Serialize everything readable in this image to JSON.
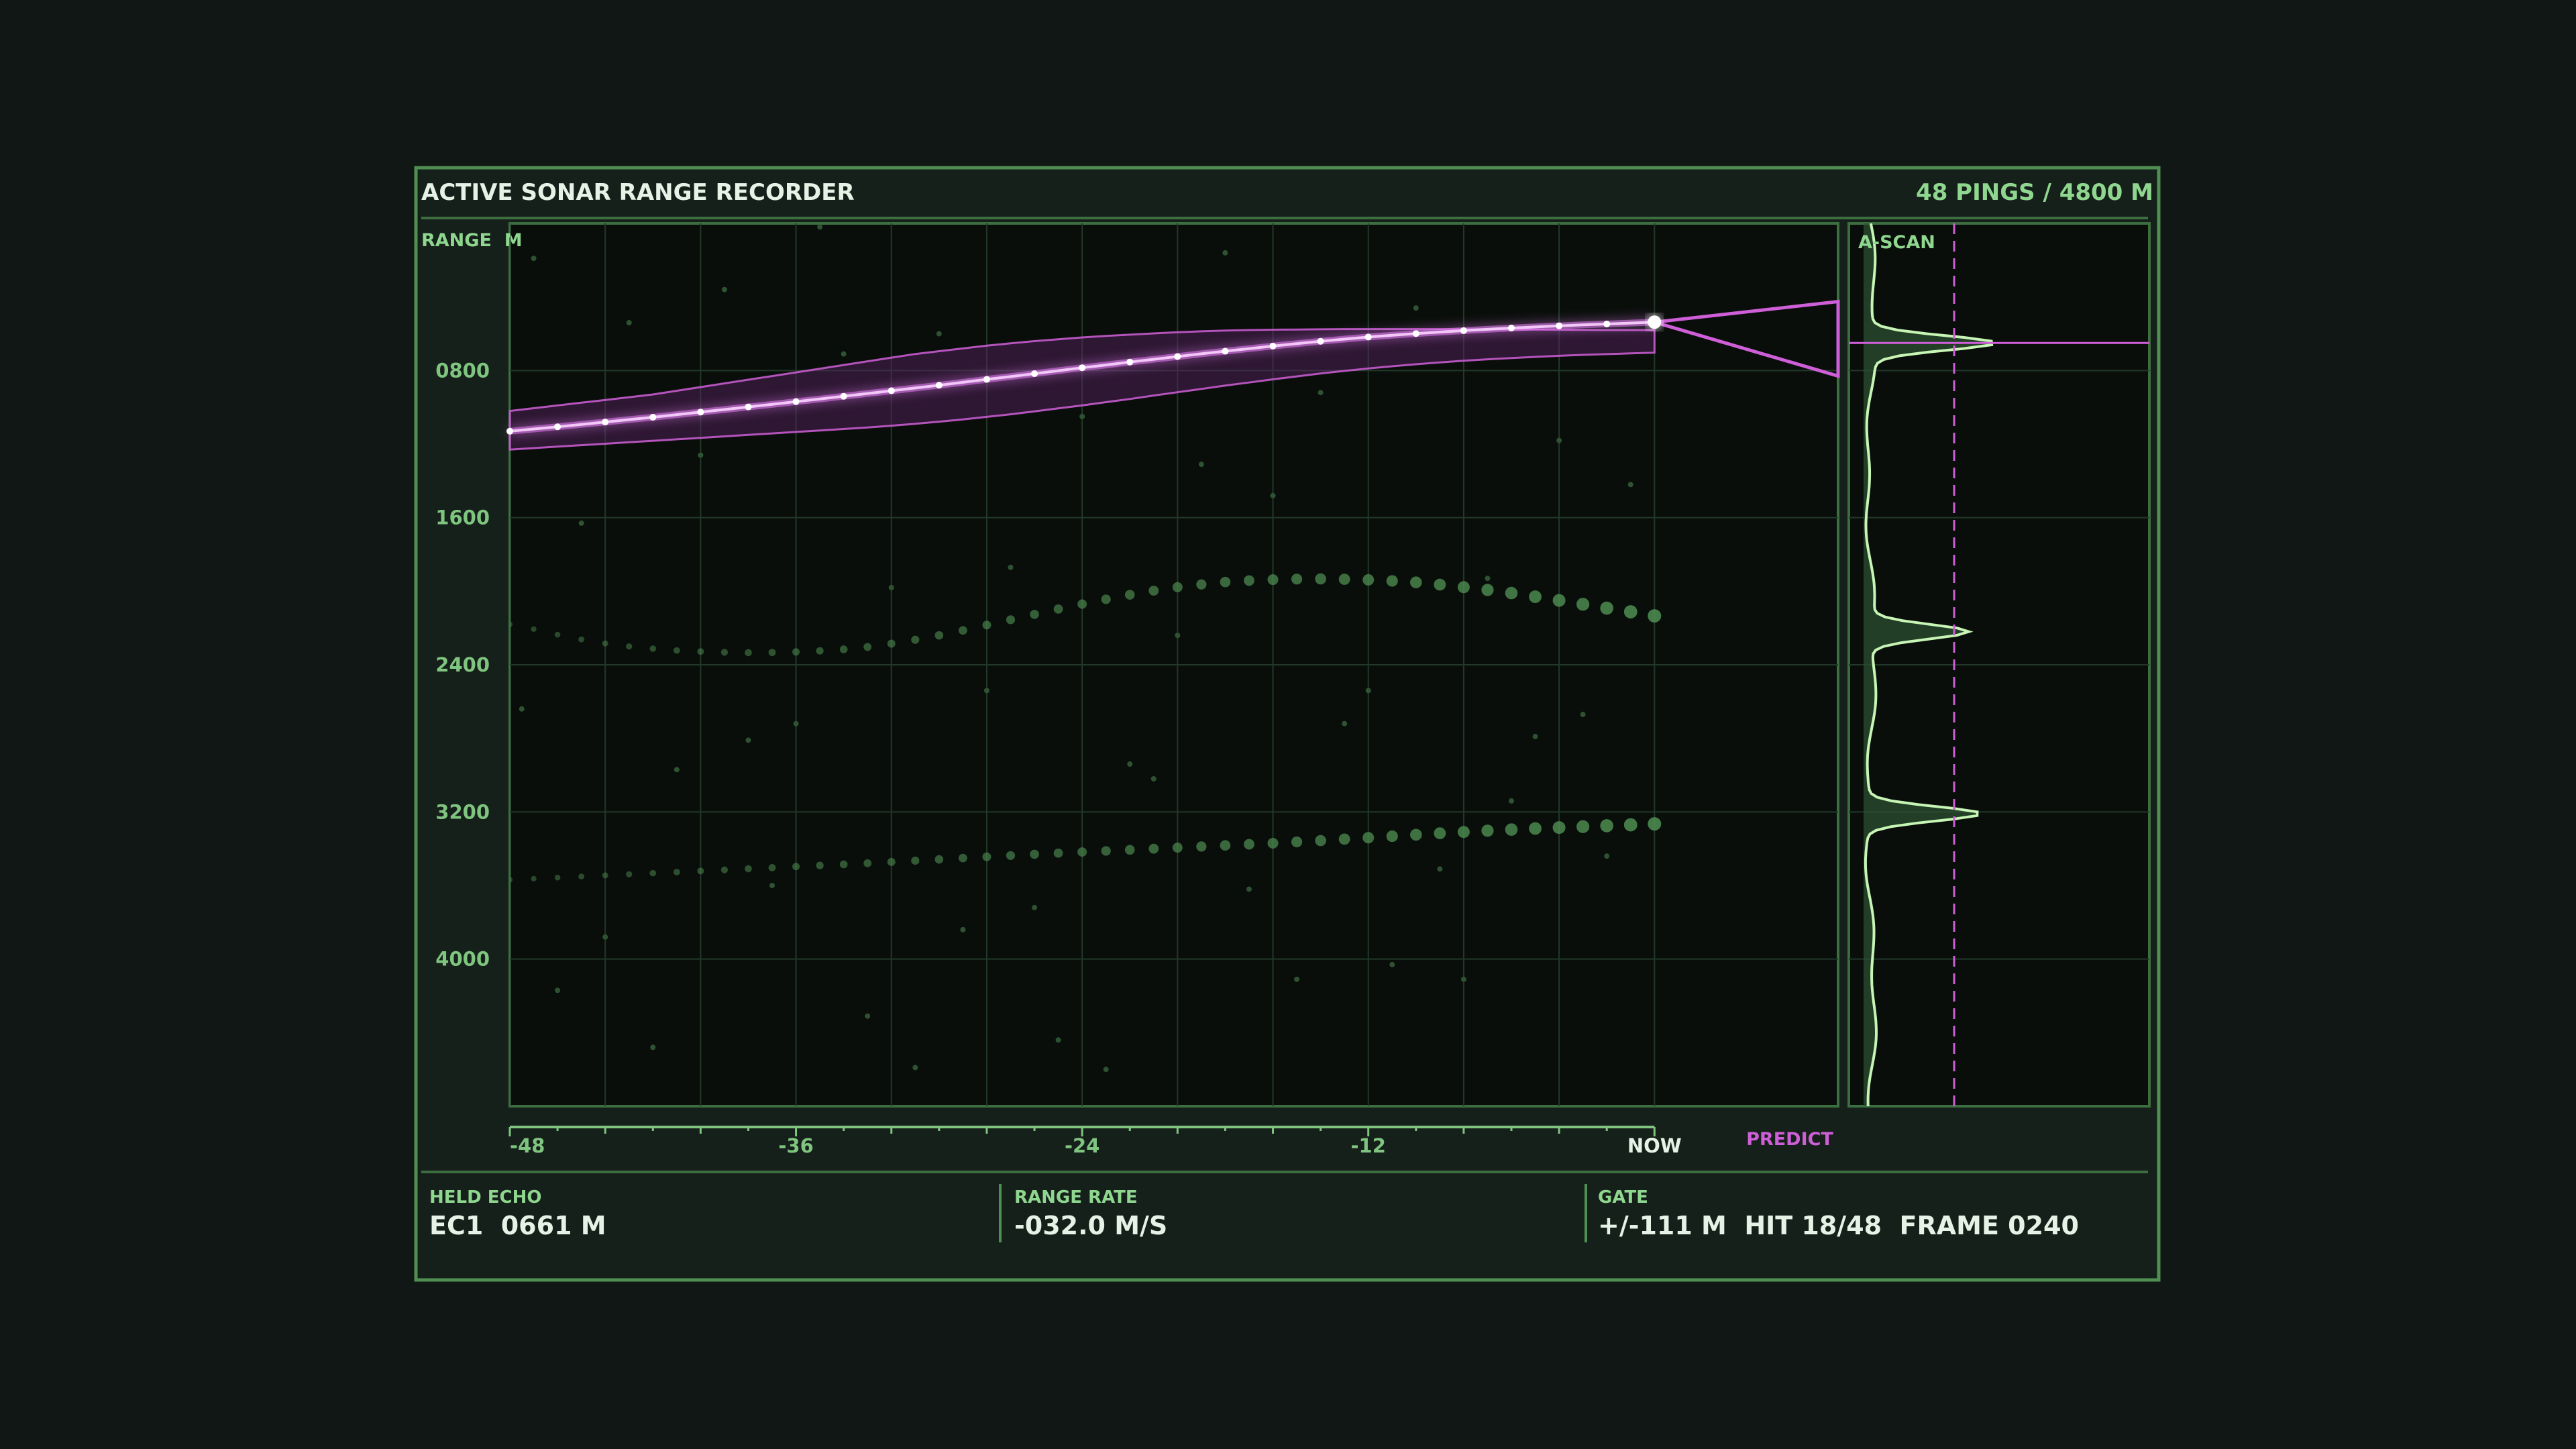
{
  "header": {
    "title": "ACTIVE SONAR RANGE RECORDER",
    "summary": "48 PINGS / 4800 M"
  },
  "colors": {
    "background": "#111714",
    "panel": "#16201b",
    "plot": "#0a0e0b",
    "accent_green": "#7fc47f",
    "grid": "#223828",
    "text_light": "#e6f2e6",
    "track_magenta": "#cf5fd8",
    "track_core": "#f3c8f8"
  },
  "chart_data": {
    "type": "scatter",
    "ylabel": "RANGE  M",
    "y_ticks": [
      "0800",
      "1600",
      "2400",
      "3200",
      "4000"
    ],
    "x_ticks": [
      "-48",
      "-36",
      "-24",
      "-12",
      "NOW"
    ],
    "predict_label": "PREDICT",
    "xlim": [
      -48,
      7.7
    ],
    "ylim": [
      0,
      4800
    ],
    "y_inverted": true,
    "grid": true,
    "held_track": {
      "x": [
        -48,
        -47,
        -46,
        -45,
        -44,
        -43,
        -42,
        -41,
        -40,
        -39,
        -38,
        -37,
        -36,
        -35,
        -34,
        -33,
        -32,
        -31,
        -30,
        -29,
        -28,
        -27,
        -26,
        -25,
        -24,
        -23,
        -22,
        -21,
        -20,
        -19,
        -18,
        -17,
        -16,
        -15,
        -14,
        -13,
        -12,
        -11,
        -10,
        -9,
        -8,
        -7,
        -6,
        -5,
        -4,
        -3,
        -2,
        -1,
        0
      ],
      "y": [
        1130,
        1118,
        1106,
        1093,
        1080,
        1067,
        1054,
        1040,
        1026,
        1012,
        998,
        984,
        969,
        955,
        940,
        925,
        910,
        895,
        880,
        864,
        848,
        833,
        817,
        801,
        785,
        770,
        754,
        739,
        724,
        709,
        695,
        681,
        667,
        654,
        641,
        629,
        618,
        608,
        599,
        591,
        583,
        576,
        569,
        563,
        557,
        552,
        547,
        542,
        537
      ],
      "band_upper": [
        1020,
        1005,
        990,
        975,
        960,
        945,
        930,
        910,
        890,
        870,
        850,
        830,
        810,
        790,
        770,
        750,
        730,
        710,
        695,
        680,
        665,
        652,
        640,
        630,
        620,
        612,
        605,
        598,
        592,
        587,
        583,
        580,
        578,
        577,
        576,
        575,
        575,
        575,
        575,
        575,
        576,
        576,
        577,
        577,
        578,
        579,
        580,
        580,
        580
      ],
      "band_lower": [
        1230,
        1222,
        1214,
        1206,
        1198,
        1190,
        1182,
        1174,
        1166,
        1158,
        1150,
        1142,
        1134,
        1126,
        1118,
        1110,
        1100,
        1090,
        1078,
        1066,
        1052,
        1038,
        1022,
        1006,
        990,
        972,
        955,
        936,
        918,
        900,
        882,
        865,
        848,
        832,
        816,
        802,
        789,
        777,
        766,
        756,
        747,
        739,
        732,
        726,
        720,
        715,
        711,
        707,
        703
      ]
    },
    "prediction": {
      "x_start": 0,
      "x_end": 7.7,
      "y_start_upper": 537,
      "y_start_lower": 537,
      "y_end_upper": 425,
      "y_end_lower": 830
    },
    "gate": {
      "x": 0,
      "y_top": 426,
      "y_bottom": 648
    },
    "echo_track_2": {
      "x": [
        -48,
        -47,
        -46,
        -45,
        -44,
        -43,
        -42,
        -41,
        -40,
        -39,
        -38,
        -37,
        -36,
        -35,
        -34,
        -33,
        -32,
        -31,
        -30,
        -29,
        -28,
        -27,
        -26,
        -25,
        -24,
        -23,
        -22,
        -21,
        -20,
        -19,
        -18,
        -17,
        -16,
        -15,
        -14,
        -13,
        -12,
        -11,
        -10,
        -9,
        -8,
        -7,
        -6,
        -5,
        -4,
        -3,
        -2,
        -1,
        0
      ],
      "y": [
        2180,
        2206,
        2236,
        2262,
        2284,
        2300,
        2312,
        2322,
        2328,
        2332,
        2334,
        2333,
        2330,
        2324,
        2316,
        2303,
        2285,
        2264,
        2240,
        2213,
        2184,
        2155,
        2126,
        2097,
        2070,
        2044,
        2019,
        1997,
        1978,
        1963,
        1950,
        1942,
        1937,
        1934,
        1933,
        1935,
        1938,
        1944,
        1952,
        1964,
        1978,
        1993,
        2010,
        2030,
        2050,
        2071,
        2092,
        2112,
        2134
      ]
    },
    "echo_track_3": {
      "x": [
        -48,
        -47,
        -46,
        -45,
        -44,
        -43,
        -42,
        -41,
        -40,
        -39,
        -38,
        -37,
        -36,
        -35,
        -34,
        -33,
        -32,
        -31,
        -30,
        -29,
        -28,
        -27,
        -26,
        -25,
        -24,
        -23,
        -22,
        -21,
        -20,
        -19,
        -18,
        -17,
        -16,
        -15,
        -14,
        -13,
        -12,
        -11,
        -10,
        -9,
        -8,
        -7,
        -6,
        -5,
        -4,
        -3,
        -2,
        -1,
        0
      ],
      "y": [
        3569,
        3563,
        3557,
        3551,
        3545,
        3539,
        3533,
        3527,
        3521,
        3515,
        3509,
        3503,
        3497,
        3491,
        3485,
        3479,
        3472,
        3465,
        3458,
        3451,
        3444,
        3437,
        3430,
        3424,
        3418,
        3412,
        3406,
        3400,
        3394,
        3388,
        3382,
        3376,
        3370,
        3363,
        3356,
        3348,
        3340,
        3332,
        3324,
        3316,
        3309,
        3302,
        3296,
        3290,
        3285,
        3280,
        3275,
        3270,
        3265
      ]
    },
    "clutter": [
      [
        -47,
        190
      ],
      [
        -43,
        540
      ],
      [
        -39,
        360
      ],
      [
        -35,
        20
      ],
      [
        -30,
        600
      ],
      [
        -27,
        1870
      ],
      [
        -24,
        1050
      ],
      [
        -20,
        2240
      ],
      [
        -17,
        3620
      ],
      [
        -14,
        920
      ],
      [
        -10,
        460
      ],
      [
        -6,
        3140
      ],
      [
        -46,
        4170
      ],
      [
        -42,
        4480
      ],
      [
        -38,
        2810
      ],
      [
        -33,
        4310
      ],
      [
        -29,
        3840
      ],
      [
        -25,
        4440
      ],
      [
        -21,
        3020
      ],
      [
        -16,
        1480
      ],
      [
        -12,
        2540
      ],
      [
        -8,
        4110
      ],
      [
        -3,
        2670
      ],
      [
        -1,
        1420
      ],
      [
        -45,
        1630
      ],
      [
        -41,
        2970
      ],
      [
        -37,
        3600
      ],
      [
        -34,
        710
      ],
      [
        -31,
        4590
      ],
      [
        -28,
        2540
      ],
      [
        -23,
        4600
      ],
      [
        -19,
        1310
      ],
      [
        -15,
        4110
      ],
      [
        -11,
        4030
      ],
      [
        -7,
        1930
      ],
      [
        -2,
        3440
      ],
      [
        -44,
        3880
      ],
      [
        -40,
        1260
      ],
      [
        -36,
        2720
      ],
      [
        -32,
        1980
      ],
      [
        -26,
        3720
      ],
      [
        -22,
        2940
      ],
      [
        -18,
        160
      ],
      [
        -13,
        2720
      ],
      [
        -9,
        3510
      ],
      [
        -5,
        2790
      ],
      [
        -4,
        1180
      ],
      [
        -47.5,
        2640
      ]
    ]
  },
  "ascan": {
    "label": "A-SCAN",
    "peaks": [
      {
        "range": 650,
        "amp": 1.0
      },
      {
        "range": 2220,
        "amp": 0.8
      },
      {
        "range": 3210,
        "amp": 0.92
      }
    ],
    "threshold": 0.75,
    "held_range": 650
  },
  "footer": {
    "held_echo": {
      "label": "HELD ECHO",
      "value": "EC1  0661 M"
    },
    "range_rate": {
      "label": "RANGE RATE",
      "value": "-032.0 M/S"
    },
    "gate": {
      "label": "GATE",
      "value": "+/-111 M  HIT 18/48  FRAME 0240"
    }
  }
}
